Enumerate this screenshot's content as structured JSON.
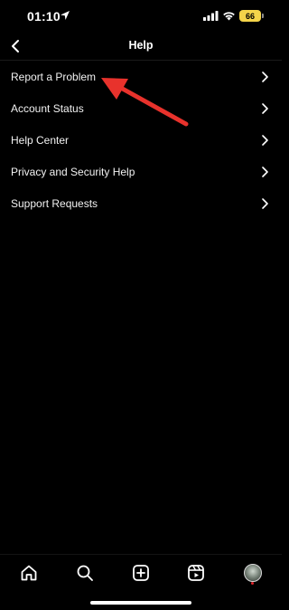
{
  "status_bar": {
    "time": "01:10",
    "battery_level": "66",
    "battery_color": "#f4d44a",
    "icons": [
      "location-arrow-icon",
      "cellular-signal-icon",
      "wifi-icon",
      "battery-icon"
    ]
  },
  "header": {
    "title": "Help",
    "back_icon": "chevron-left-icon"
  },
  "menu": {
    "items": [
      {
        "label": "Report a Problem",
        "icon": "chevron-right-icon"
      },
      {
        "label": "Account Status",
        "icon": "chevron-right-icon"
      },
      {
        "label": "Help Center",
        "icon": "chevron-right-icon"
      },
      {
        "label": "Privacy and Security Help",
        "icon": "chevron-right-icon"
      },
      {
        "label": "Support Requests",
        "icon": "chevron-right-icon"
      }
    ]
  },
  "annotation": {
    "arrow_color": "#e8322c",
    "points_to": "Report a Problem"
  },
  "bottom_nav": {
    "items": [
      "home-icon",
      "search-icon",
      "create-post-icon",
      "reels-icon",
      "profile-avatar"
    ],
    "notification_dot_color": "#e0242a"
  }
}
